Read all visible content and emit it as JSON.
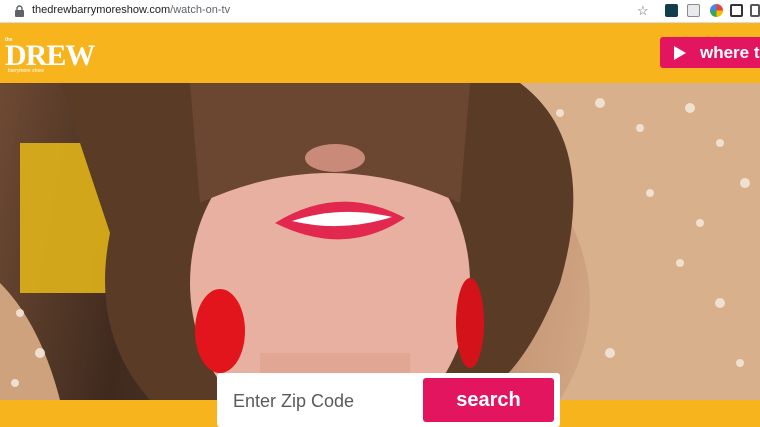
{
  "browser": {
    "url_domain": "thedrewbarrymoreshow.com",
    "url_path": "/watch-on-tv"
  },
  "header": {
    "logo_top": "the",
    "logo_main": "DREW",
    "logo_sub": "barrymore show",
    "where_button_label": "where to"
  },
  "search": {
    "placeholder": "Enter Zip Code",
    "button_label": "search"
  },
  "colors": {
    "brand_yellow": "#f7b41c",
    "brand_pink": "#e4155f"
  }
}
